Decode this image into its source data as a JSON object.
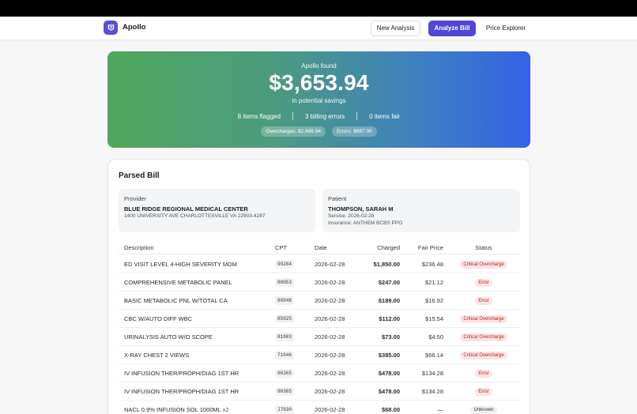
{
  "nav": {
    "brand": "Apollo",
    "new_analysis": "New Analysis",
    "analyze_bill": "Analyze Bill",
    "price_explorer": "Price Explorer"
  },
  "hero": {
    "kicker": "Apollo found",
    "amount": "$3,653.94",
    "subtitle": "in potential savings",
    "stats": [
      "8 items flagged",
      "3 billing errors",
      "0 items fair"
    ],
    "pills": [
      "Overcharges: $2,666.94",
      "Errors: $987.00"
    ]
  },
  "bill": {
    "title": "Parsed Bill",
    "provider": {
      "label": "Provider",
      "name": "BLUE RIDGE REGIONAL MEDICAL CENTER",
      "address": "1400 UNIVERSITY AVE CHARLOTTESVILLE VA 22903-4287"
    },
    "patient": {
      "label": "Patient",
      "name": "THOMPSON, SARAH M",
      "service": "Service: 2026-02-28",
      "insurance": "Insurance: ANTHEM BCBS PPO"
    },
    "columns": [
      "Description",
      "CPT",
      "Date",
      "Charged",
      "Fair Price",
      "Status"
    ],
    "rows": [
      {
        "description": "ED VISIT LEVEL 4-HIGH SEVERITY MDM",
        "qty": "",
        "cpt": "99284",
        "date": "2026-02-28",
        "charged": "$1,850.00",
        "fair": "$236.48",
        "status": "Critical Overcharge",
        "status_type": "critical"
      },
      {
        "description": "COMPREHENSIVE METABOLIC PANEL",
        "qty": "",
        "cpt": "80053",
        "date": "2026-02-28",
        "charged": "$247.00",
        "fair": "$21.12",
        "status": "Error",
        "status_type": "error"
      },
      {
        "description": "BASIC METABOLIC PNL W/TOTAL CA",
        "qty": "",
        "cpt": "80048",
        "date": "2026-02-28",
        "charged": "$189.00",
        "fair": "$16.92",
        "status": "Error",
        "status_type": "error"
      },
      {
        "description": "CBC W/AUTO DIFF WBC",
        "qty": "",
        "cpt": "85025",
        "date": "2026-02-28",
        "charged": "$112.00",
        "fair": "$15.54",
        "status": "Critical Overcharge",
        "status_type": "critical"
      },
      {
        "description": "URINALYSIS AUTO W/O SCOPE",
        "qty": "",
        "cpt": "81003",
        "date": "2026-02-28",
        "charged": "$73.00",
        "fair": "$4.50",
        "status": "Critical Overcharge",
        "status_type": "critical"
      },
      {
        "description": "X-RAY CHEST 2 VIEWS",
        "qty": "",
        "cpt": "71046",
        "date": "2026-02-28",
        "charged": "$385.00",
        "fair": "$66.14",
        "status": "Critical Overcharge",
        "status_type": "critical"
      },
      {
        "description": "IV INFUSION THER/PROPH/DIAG 1ST HR",
        "qty": "",
        "cpt": "96365",
        "date": "2026-02-28",
        "charged": "$478.00",
        "fair": "$134.28",
        "status": "Error",
        "status_type": "error"
      },
      {
        "description": "IV INFUSION THER/PROPH/DIAG 1ST HR",
        "qty": "",
        "cpt": "96365",
        "date": "2026-02-28",
        "charged": "$478.00",
        "fair": "$134.28",
        "status": "Error",
        "status_type": "error"
      },
      {
        "description": "NACL 0.9% INFUSION SOL 1000ML",
        "qty": "x2",
        "cpt": "J7030",
        "date": "2026-02-28",
        "charged": "$68.00",
        "fair": "—",
        "status": "Unknown",
        "status_type": "unknown"
      }
    ]
  },
  "colors": {
    "accent": "#5146d6",
    "hero_gradient_start": "#4ea85b",
    "hero_gradient_end": "#3560e6",
    "badge_error_bg": "#fde3e3",
    "badge_error_text": "#b42323"
  }
}
